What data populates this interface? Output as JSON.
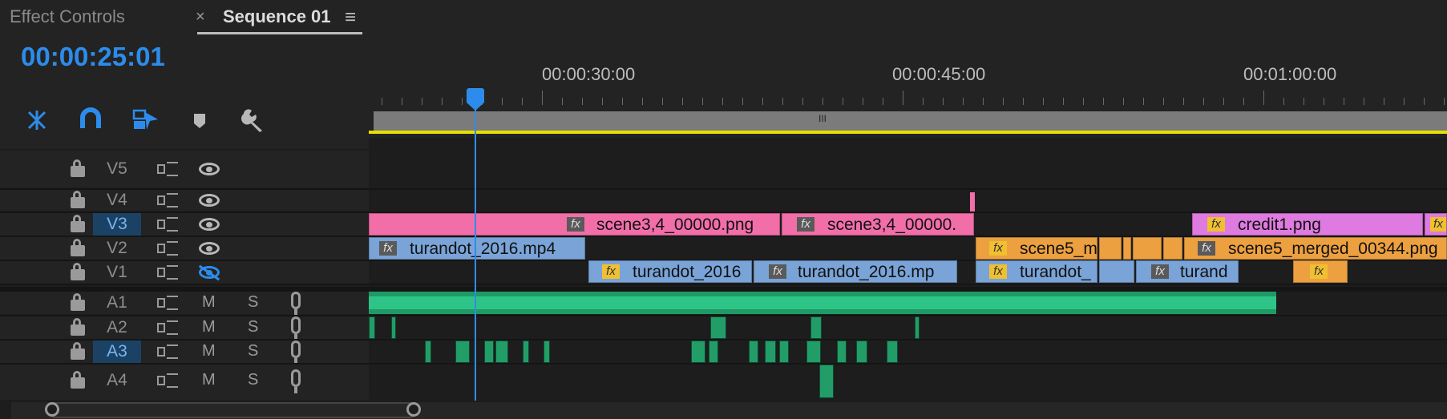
{
  "tabs": {
    "effect_controls": "Effect Controls",
    "sequence": "Sequence 01",
    "close": "×",
    "menu": "≡"
  },
  "timecode": "00:00:25:01",
  "ruler_labels": [
    "00:00:30:00",
    "00:00:45:00",
    "00:01:00:00"
  ],
  "work_area_handle": "III",
  "tracks": {
    "video": [
      {
        "name": "V5"
      },
      {
        "name": "V4"
      },
      {
        "name": "V3",
        "selected": true
      },
      {
        "name": "V2"
      },
      {
        "name": "V1",
        "hidden": true
      }
    ],
    "audio": [
      {
        "name": "A1",
        "m": "M",
        "s": "S"
      },
      {
        "name": "A2",
        "m": "M",
        "s": "S"
      },
      {
        "name": "A3",
        "m": "M",
        "s": "S",
        "selected": true
      },
      {
        "name": "A4",
        "m": "M",
        "s": "S"
      }
    ]
  },
  "clips": {
    "v3a": "scene3,4_00000.png",
    "v3b": "scene3,4_00000.",
    "v3c": "credit1.png",
    "v2a": "turandot_2016.mp4",
    "v2b": "scene5_m",
    "v2c": "scene5_merged_00344.png",
    "v1a": "turandot_2016",
    "v1b": "turandot_2016.mp",
    "v1c": "turandot_",
    "v1d": "turand"
  },
  "fx_label": "fx",
  "colors": {
    "accent": "#2d8ceb",
    "pink": "#f26ea9",
    "blue": "#7aa4d8",
    "orange": "#eca040",
    "violet": "#df7ae0",
    "audio": "#2fc487",
    "inout": "#e6e000"
  },
  "icons": [
    "snap-nest-icon",
    "magnet-icon",
    "linked-selection-icon",
    "add-marker-icon",
    "wrench-icon",
    "lock-icon",
    "sync-lock-icon",
    "eye-icon",
    "mic-icon"
  ]
}
